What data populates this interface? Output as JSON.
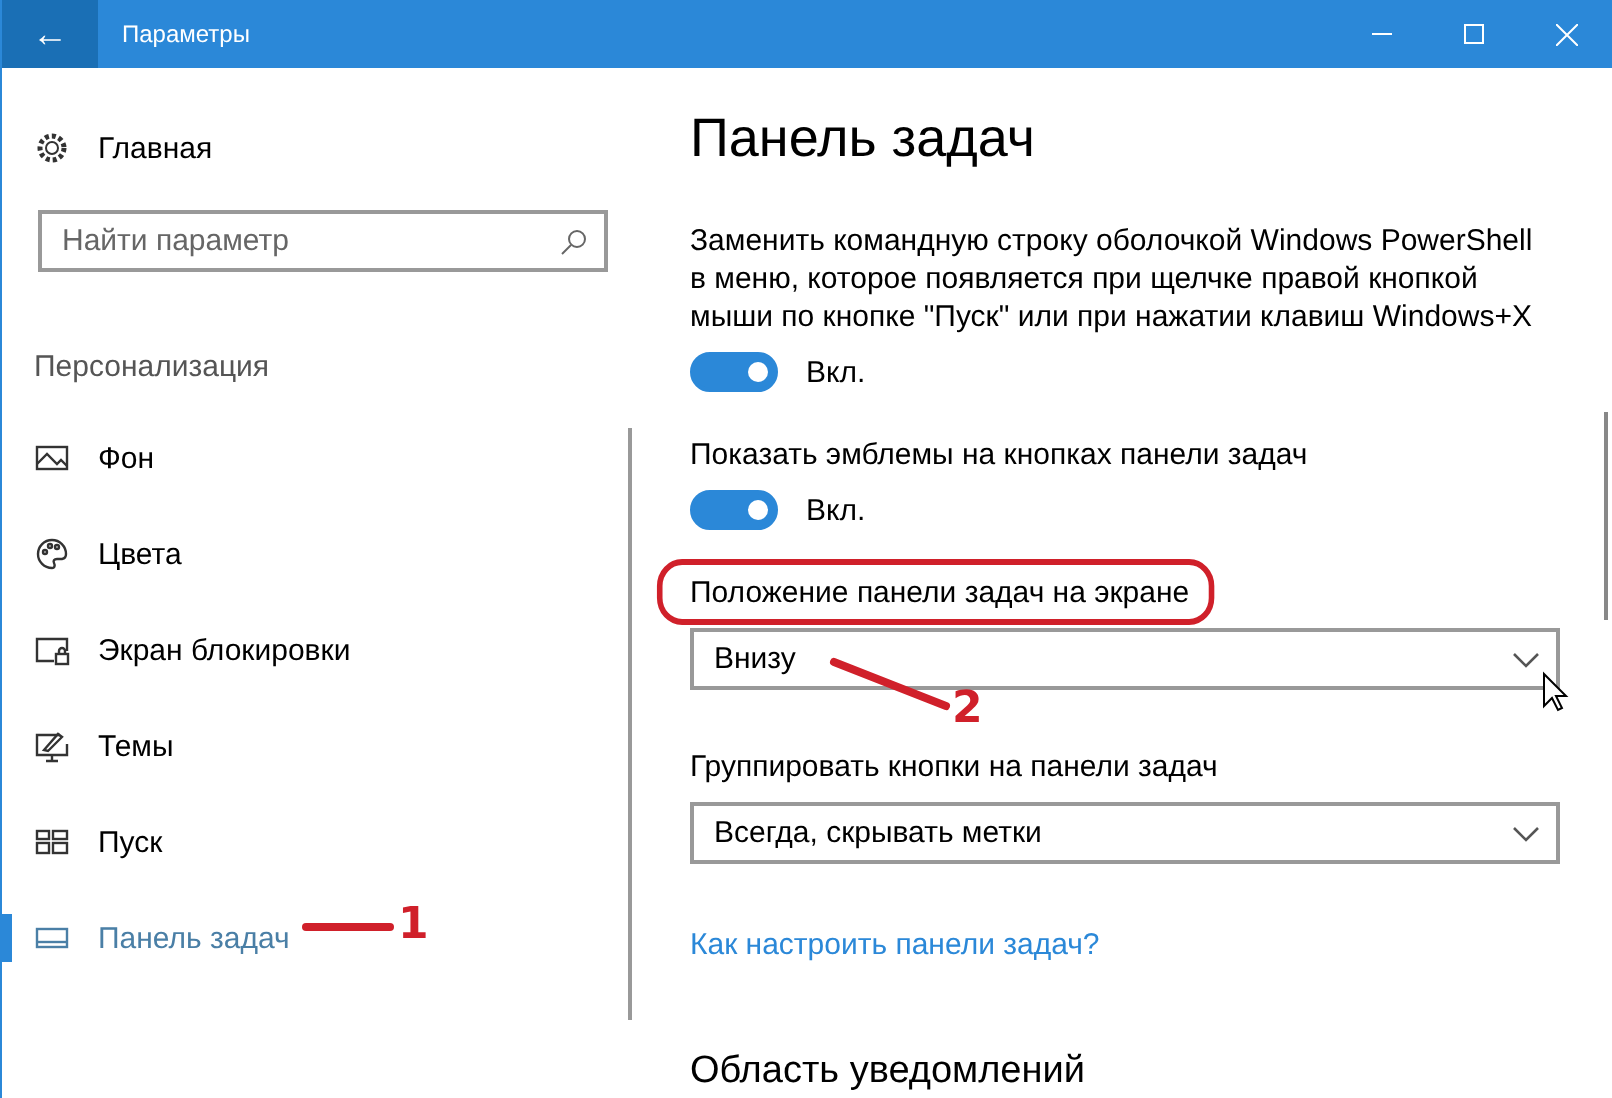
{
  "window": {
    "title": "Параметры",
    "back_button": "←"
  },
  "sidebar": {
    "home": "Главная",
    "search": {
      "placeholder": "Найти параметр"
    },
    "section": "Персонализация",
    "items": [
      {
        "label": "Фон",
        "selected": false
      },
      {
        "label": "Цвета",
        "selected": false
      },
      {
        "label": "Экран блокировки",
        "selected": false
      },
      {
        "label": "Темы",
        "selected": false
      },
      {
        "label": "Пуск",
        "selected": false
      },
      {
        "label": "Панель задач",
        "selected": true
      }
    ]
  },
  "content": {
    "title": "Панель задач",
    "settings": [
      {
        "kind": "toggle",
        "label": "Заменить командную строку оболочкой Windows PowerShell в меню, которое появляется при щелчке правой кнопкой мыши по кнопке \"Пуск\" или при нажатии клавиш Windows+X",
        "on": true,
        "state_text": "Вкл."
      },
      {
        "kind": "toggle",
        "label": "Показать эмблемы на кнопках панели задач",
        "on": true,
        "state_text": "Вкл."
      },
      {
        "kind": "dropdown",
        "label": "Положение панели задач на экране",
        "value": "Внизу",
        "highlighted": true
      },
      {
        "kind": "dropdown",
        "label": "Группировать кнопки на панели задач",
        "value": "Всегда, скрывать метки",
        "highlighted": false
      },
      {
        "kind": "link",
        "label": "Как настроить панели задач?"
      }
    ],
    "section_title": "Область уведомлений"
  },
  "annotations": [
    {
      "label": "1"
    },
    {
      "label": "2"
    }
  ]
}
